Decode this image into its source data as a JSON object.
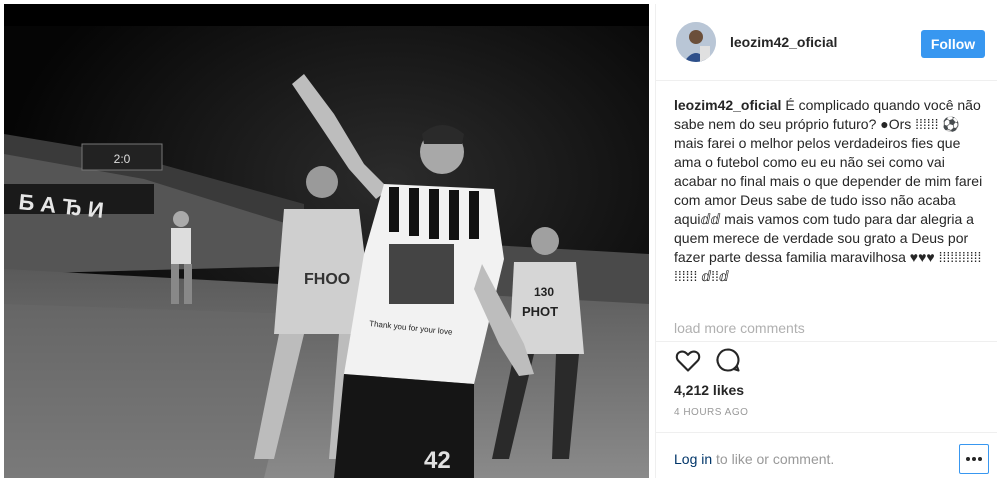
{
  "photo": {
    "scoreboard_text": "2:0",
    "banner_text": "Б А Ђ И",
    "tshirt_text": "Thank you for your love",
    "player_number": "42",
    "steward_left_text": "FHOO",
    "steward_right_number": "130",
    "steward_right_text": "PHOT"
  },
  "header": {
    "username": "leozim42_oficial",
    "follow_label": "Follow"
  },
  "caption": {
    "username": "leozim42_oficial",
    "text": "É complicado quando você não sabe nem do seu próprio futuro? ●Ors ⁞⁞⁞⁞⁞⁞ ⚽ mais farei o melhor pelos verdadeiros fies que ama o futebol como eu eu não sei como vai acabar no final mais o que depender de mim farei com amor Deus sabe de tudo isso não acaba aquiⅆⅆ mais vamos com tudo para dar alegria a quem merece de verdade sou grato a Deus por fazer parte dessa familia maravilhosa ♥♥♥ ⁞⁞⁞⁞⁞⁞⁞⁞⁞⁞⁞ ⁞⁞⁞⁞⁞⁞ ⅆ⁞⁞ⅆ"
  },
  "load_more_label": "load more comments",
  "likes_text": "4,212 likes",
  "time_text": "4 HOURS AGO",
  "login": {
    "link_text": "Log in",
    "rest_text": " to like or comment."
  },
  "icons": {
    "like": "heart-icon",
    "comment": "comment-icon",
    "more": "ellipsis-icon"
  },
  "colors": {
    "follow_blue": "#3897f0",
    "text_dark": "#262626",
    "muted": "#999999"
  }
}
